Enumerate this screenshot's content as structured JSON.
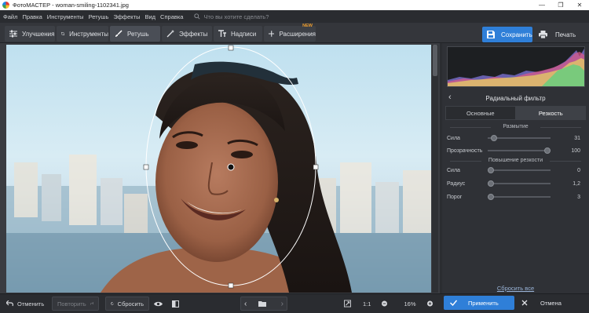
{
  "window": {
    "title": "ФотоМАСТЕР - woman-smiling-1102341.jpg",
    "controls": [
      "—",
      "❐",
      "✕"
    ]
  },
  "menu": {
    "items": [
      "Файл",
      "Правка",
      "Инструменты",
      "Ретушь",
      "Эффекты",
      "Вид",
      "Справка"
    ],
    "search_placeholder": "Что вы хотите сделать?"
  },
  "toolbar": {
    "tabs": [
      {
        "label": "Улучшения",
        "icon": "sliders-icon"
      },
      {
        "label": "Инструменты",
        "icon": "crop-icon"
      },
      {
        "label": "Ретушь",
        "icon": "brush-icon",
        "active": true
      },
      {
        "label": "Эффекты",
        "icon": "magic-wand-icon"
      },
      {
        "label": "Надписи",
        "icon": "text-icon"
      },
      {
        "label": "Расширения",
        "icon": "plus-icon",
        "badge": "NEW"
      }
    ],
    "save_label": "Сохранить",
    "print_label": "Печать"
  },
  "panel": {
    "title": "Радиальный фильтр",
    "tabs": [
      {
        "label": "Основные",
        "active": false
      },
      {
        "label": "Резкость",
        "active": true
      }
    ],
    "section_blur": "Размытие",
    "blur_sliders": [
      {
        "label": "Сила",
        "value": "31",
        "fraction": 0.05
      },
      {
        "label": "Прозрачность",
        "value": "100",
        "fraction": 1.0
      }
    ],
    "section_sharpen": "Повышение резкости",
    "sharpen_sliders": [
      {
        "label": "Сила",
        "value": "0",
        "fraction": 0.0
      },
      {
        "label": "Радиус",
        "value": "1,2",
        "fraction": 0.0
      },
      {
        "label": "Порог",
        "value": "3",
        "fraction": 0.0
      }
    ],
    "reset_all": "Сбросить все"
  },
  "bottom": {
    "undo_label": "Отменить",
    "redo_label": "Повторить",
    "reset_label": "Сбросить",
    "ratio_label": "1:1",
    "zoom_value": "16%",
    "apply_label": "Применить",
    "cancel_label": "Отмена"
  },
  "colors": {
    "accent": "#2f7fd8",
    "new_badge": "#f0a030"
  }
}
